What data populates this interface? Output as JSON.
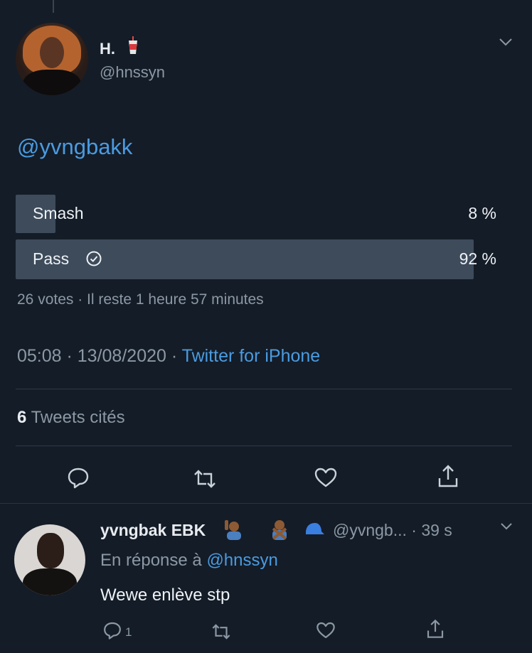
{
  "tweet": {
    "author_name": "H.",
    "author_handle": "@hnssyn",
    "text": "@yvngbakk",
    "poll": {
      "options": [
        {
          "label": "Smash",
          "percent": "8 %",
          "share": 0.08
        },
        {
          "label": "Pass",
          "percent": "92 %",
          "share": 0.92,
          "selected": true
        }
      ],
      "summary": "26 votes · Il reste 1 heure 57 minutes"
    },
    "time": "05:08 · 13/08/2020 · ",
    "source": "Twitter for iPhone",
    "quote_count": "6",
    "quote_label": " Tweets cités"
  },
  "reply": {
    "author_name": "yvngbak EBK",
    "author_handle": "@yvngb... · 39 s",
    "in_reply_prefix": "En réponse à ",
    "in_reply_handle": "@hnssyn",
    "text": "Wewe enlève stp",
    "reply_count": "1"
  },
  "colors": {
    "background": "#141c27",
    "accent": "#4a9be0",
    "poll_bar": "#3e4b5b",
    "muted_text": "#8b98a5"
  },
  "icons": [
    "chevron-down-icon",
    "check-circle-icon",
    "reply-icon",
    "retweet-icon",
    "like-icon",
    "share-icon",
    "drink-cup-icon"
  ]
}
